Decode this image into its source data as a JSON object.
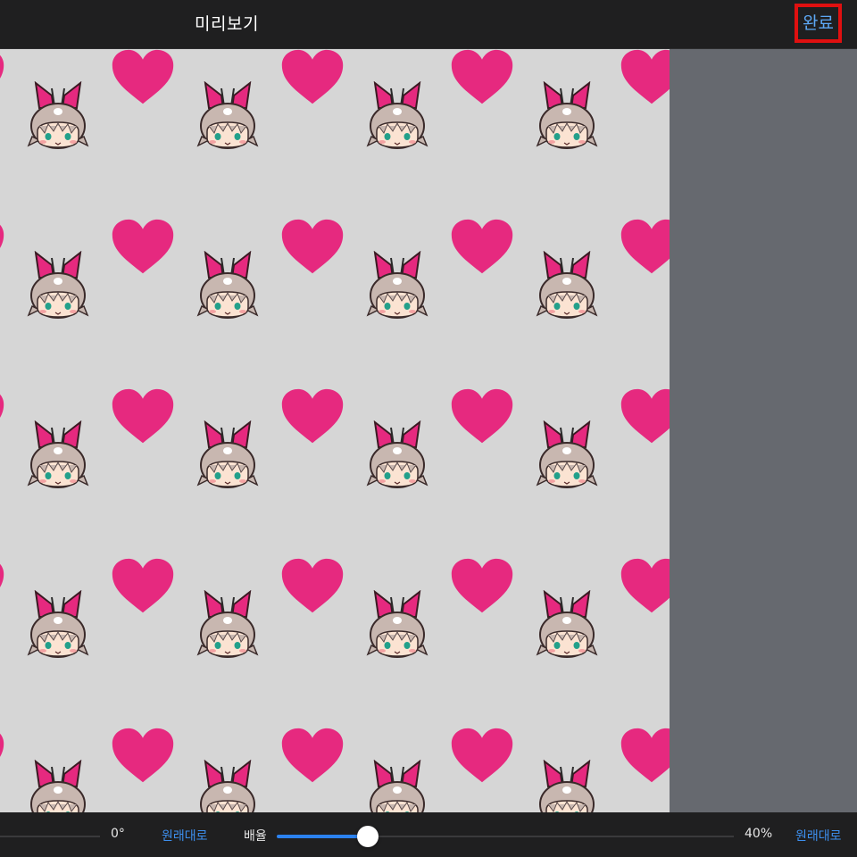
{
  "header": {
    "title": "미리보기",
    "done_label": "완료"
  },
  "pattern": {
    "background_color": "#d6d6d6",
    "heart_color": "#e6297f",
    "side_panel_color": "#66696f"
  },
  "bottom": {
    "rotation_value": "0°",
    "reset_rotation_label": "원래대로",
    "scale_label": "배율",
    "scale_value": "40%",
    "scale_fraction": 0.2,
    "reset_scale_label": "원래대로"
  }
}
